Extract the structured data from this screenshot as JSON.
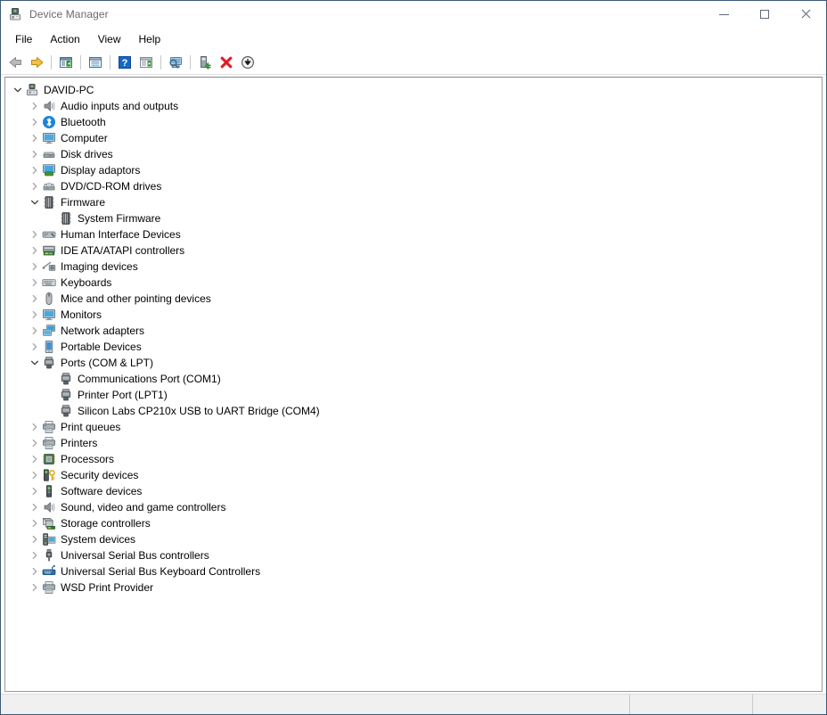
{
  "window": {
    "title": "Device Manager",
    "title_icon": "device-manager-icon",
    "caption": {
      "minimize": "minimize-icon",
      "maximize": "maximize-icon",
      "close": "close-icon"
    }
  },
  "menubar": {
    "items": [
      {
        "label": "File",
        "name": "menu-file"
      },
      {
        "label": "Action",
        "name": "menu-action"
      },
      {
        "label": "View",
        "name": "menu-view"
      },
      {
        "label": "Help",
        "name": "menu-help"
      }
    ]
  },
  "toolbar": {
    "buttons": [
      {
        "name": "back-button",
        "icon": "back-arrow-icon",
        "title": "Back"
      },
      {
        "name": "forward-button",
        "icon": "forward-arrow-icon",
        "title": "Forward"
      },
      {
        "name": "separator-1",
        "icon": "separator",
        "title": ""
      },
      {
        "name": "show-hide-console-tree",
        "icon": "console-tree-icon",
        "title": "Show/Hide Console Tree"
      },
      {
        "name": "separator-2",
        "icon": "separator",
        "title": ""
      },
      {
        "name": "properties-button",
        "icon": "properties-icon",
        "title": "Properties"
      },
      {
        "name": "separator-3",
        "icon": "separator",
        "title": ""
      },
      {
        "name": "help-button",
        "icon": "help-question-icon",
        "title": "Help"
      },
      {
        "name": "show-hide-action-pane",
        "icon": "action-pane-icon",
        "title": "Show/Hide Action Pane"
      },
      {
        "name": "separator-4",
        "icon": "separator",
        "title": ""
      },
      {
        "name": "scan-hardware-button",
        "icon": "scan-hardware-changes-icon",
        "title": "Scan for hardware changes"
      },
      {
        "name": "separator-5",
        "icon": "separator",
        "title": ""
      },
      {
        "name": "update-driver-button",
        "icon": "update-driver-icon",
        "title": "Update Driver Software"
      },
      {
        "name": "uninstall-button",
        "icon": "uninstall-device-icon",
        "title": "Uninstall"
      },
      {
        "name": "disable-button",
        "icon": "disable-device-icon",
        "title": "Disable"
      }
    ]
  },
  "tree": {
    "nodes": [
      {
        "label": "DAVID-PC",
        "depth": 0,
        "state": "expanded",
        "icon": "computer-root-icon"
      },
      {
        "label": "Audio inputs and outputs",
        "depth": 1,
        "state": "collapsed",
        "icon": "speaker-icon"
      },
      {
        "label": "Bluetooth",
        "depth": 1,
        "state": "collapsed",
        "icon": "bluetooth-icon"
      },
      {
        "label": "Computer",
        "depth": 1,
        "state": "collapsed",
        "icon": "monitor-icon"
      },
      {
        "label": "Disk drives",
        "depth": 1,
        "state": "collapsed",
        "icon": "disk-drive-icon"
      },
      {
        "label": "Display adaptors",
        "depth": 1,
        "state": "collapsed",
        "icon": "display-adapter-icon"
      },
      {
        "label": "DVD/CD-ROM drives",
        "depth": 1,
        "state": "collapsed",
        "icon": "optical-drive-icon"
      },
      {
        "label": "Firmware",
        "depth": 1,
        "state": "expanded",
        "icon": "firmware-chip-icon"
      },
      {
        "label": "System Firmware",
        "depth": 2,
        "state": "leaf",
        "icon": "firmware-chip-icon"
      },
      {
        "label": "Human Interface Devices",
        "depth": 1,
        "state": "collapsed",
        "icon": "hid-icon"
      },
      {
        "label": "IDE ATA/ATAPI controllers",
        "depth": 1,
        "state": "collapsed",
        "icon": "ide-controller-icon"
      },
      {
        "label": "Imaging devices",
        "depth": 1,
        "state": "collapsed",
        "icon": "imaging-device-icon"
      },
      {
        "label": "Keyboards",
        "depth": 1,
        "state": "collapsed",
        "icon": "keyboard-icon"
      },
      {
        "label": "Mice and other pointing devices",
        "depth": 1,
        "state": "collapsed",
        "icon": "mouse-icon"
      },
      {
        "label": "Monitors",
        "depth": 1,
        "state": "collapsed",
        "icon": "monitor-icon"
      },
      {
        "label": "Network adapters",
        "depth": 1,
        "state": "collapsed",
        "icon": "network-adapter-icon"
      },
      {
        "label": "Portable Devices",
        "depth": 1,
        "state": "collapsed",
        "icon": "portable-device-icon"
      },
      {
        "label": "Ports (COM & LPT)",
        "depth": 1,
        "state": "expanded",
        "icon": "port-icon"
      },
      {
        "label": "Communications Port (COM1)",
        "depth": 2,
        "state": "leaf",
        "icon": "port-icon"
      },
      {
        "label": "Printer Port (LPT1)",
        "depth": 2,
        "state": "leaf",
        "icon": "port-icon"
      },
      {
        "label": "Silicon Labs CP210x USB to UART Bridge (COM4)",
        "depth": 2,
        "state": "leaf",
        "icon": "port-icon"
      },
      {
        "label": "Print queues",
        "depth": 1,
        "state": "collapsed",
        "icon": "printer-icon"
      },
      {
        "label": "Printers",
        "depth": 1,
        "state": "collapsed",
        "icon": "printer-icon"
      },
      {
        "label": "Processors",
        "depth": 1,
        "state": "collapsed",
        "icon": "processor-icon"
      },
      {
        "label": "Security devices",
        "depth": 1,
        "state": "collapsed",
        "icon": "security-device-icon"
      },
      {
        "label": "Software devices",
        "depth": 1,
        "state": "collapsed",
        "icon": "software-device-icon"
      },
      {
        "label": "Sound, video and game controllers",
        "depth": 1,
        "state": "collapsed",
        "icon": "speaker-icon"
      },
      {
        "label": "Storage controllers",
        "depth": 1,
        "state": "collapsed",
        "icon": "storage-controller-icon"
      },
      {
        "label": "System devices",
        "depth": 1,
        "state": "collapsed",
        "icon": "system-device-icon"
      },
      {
        "label": "Universal Serial Bus controllers",
        "depth": 1,
        "state": "collapsed",
        "icon": "usb-icon"
      },
      {
        "label": "Universal Serial Bus Keyboard Controllers",
        "depth": 1,
        "state": "collapsed",
        "icon": "usb-keyboard-icon"
      },
      {
        "label": "WSD Print Provider",
        "depth": 1,
        "state": "collapsed",
        "icon": "printer-icon"
      }
    ]
  },
  "statusbar": {
    "panes": [
      {
        "name": "status-pane-main",
        "text": ""
      },
      {
        "name": "status-pane-two",
        "text": ""
      },
      {
        "name": "status-pane-three",
        "text": ""
      }
    ]
  },
  "colors": {
    "window_border": "#3c5a76",
    "title_text": "#6a6a6a",
    "caption_glyph": "#5d6b7a",
    "toolbar_separator": "#c8c8c8",
    "tree_border": "#9a9a9a",
    "twisty": "#b0b0b0",
    "twisty_expanded": "#4a4a4a",
    "statusbar_bg": "#f0f0f0",
    "accent_blue": "#1e90d2",
    "accent_green": "#5aa02c",
    "accent_red": "#d93025",
    "accent_gold": "#e8a317"
  }
}
